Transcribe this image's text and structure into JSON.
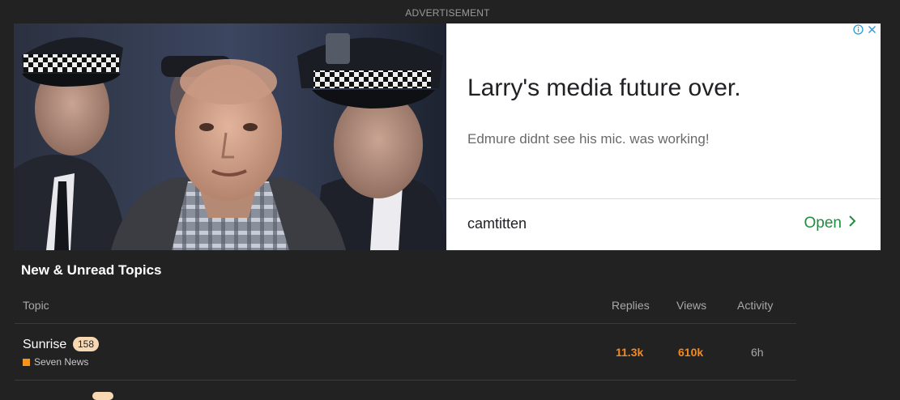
{
  "ad": {
    "label": "ADVERTISEMENT",
    "headline": "Larry's media future over.",
    "description": "Edmure didnt see his mic. was working!",
    "advertiser": "camtitten",
    "cta": "Open",
    "cta_color": "#1e8e3e",
    "info_icon": "info-icon",
    "close_icon": "close-icon"
  },
  "section": {
    "title": "New & Unread Topics"
  },
  "table": {
    "columns": {
      "topic": "Topic",
      "replies": "Replies",
      "views": "Views",
      "activity": "Activity"
    },
    "rows": [
      {
        "title": "Sunrise",
        "unread": "158",
        "category": "Seven News",
        "category_color": "#f7941d",
        "replies": "11.3k",
        "views": "610k",
        "activity": "6h"
      }
    ]
  },
  "colors": {
    "background": "#222222",
    "hot_number": "#f08a24",
    "badge": "#f8d7b3"
  }
}
